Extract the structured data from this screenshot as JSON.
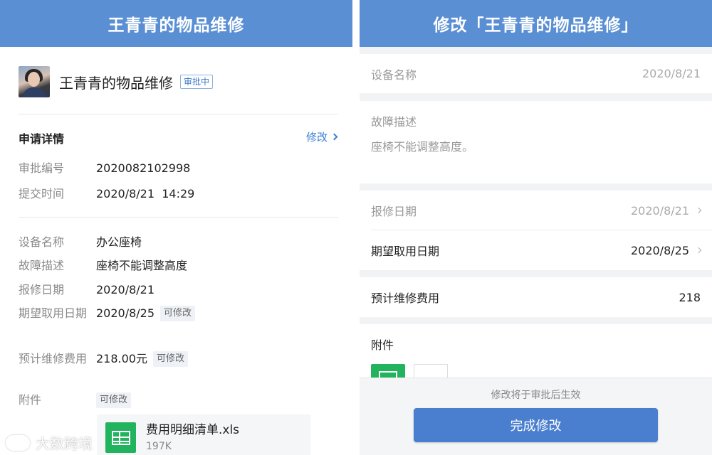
{
  "left": {
    "title": "王青青的物品维修",
    "applicant_title": "王青青的物品维修",
    "status_badge": "审批中",
    "section_title": "申请详情",
    "edit_link": "修改",
    "meta": [
      {
        "label": "审批编号",
        "value": "2020082102998"
      },
      {
        "label": "提交时间",
        "value": "2020/8/21  14:29"
      }
    ],
    "fields": [
      {
        "label": "设备名称",
        "value": "办公座椅",
        "tag": ""
      },
      {
        "label": "故障描述",
        "value": "座椅不能调整高度",
        "tag": ""
      },
      {
        "label": "报修日期",
        "value": "2020/8/21",
        "tag": ""
      },
      {
        "label": "期望取用日期",
        "value": "2020/8/25",
        "tag": "可修改"
      },
      {
        "label": "预计维修费用",
        "value": "218.00元",
        "tag": "可修改"
      },
      {
        "label": "附件",
        "value": "",
        "tag": "可修改"
      }
    ],
    "attachment": {
      "name": "费用明细清单.xls",
      "size": "197K",
      "icon": "spreadsheet-icon"
    },
    "watermark": "大数跨境"
  },
  "right": {
    "title": "修改「王青青的物品维修」",
    "device_name_label": "设备名称",
    "device_name_value": "2020/8/21",
    "fault_label": "故障描述",
    "fault_value": "座椅不能调整高度。",
    "report_date_label": "报修日期",
    "report_date_value": "2020/8/21",
    "expected_date_label": "期望取用日期",
    "expected_date_value": "2020/8/25",
    "cost_label": "预计维修费用",
    "cost_value": "218",
    "attachments_label": "附件",
    "footer_note": "修改将于审批后生效",
    "done_button": "完成修改"
  },
  "colors": {
    "header_blue": "#5a8fd4",
    "link_blue": "#3b7fd4",
    "button_blue": "#4a7fcf",
    "spreadsheet_green": "#21b35e"
  }
}
